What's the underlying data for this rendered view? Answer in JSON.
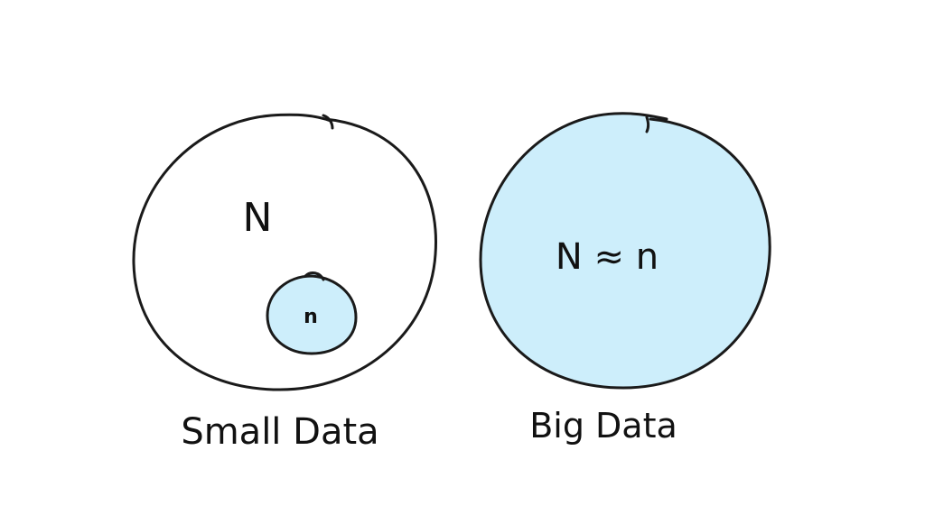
{
  "diagram": {
    "fill_color": "#cdeefb",
    "stroke_color": "#1a1a1a",
    "left": {
      "population_label": "N",
      "sample_label": "n",
      "caption": "Small Data"
    },
    "right": {
      "population_label": "N ≈ n",
      "caption": "Big Data"
    }
  }
}
